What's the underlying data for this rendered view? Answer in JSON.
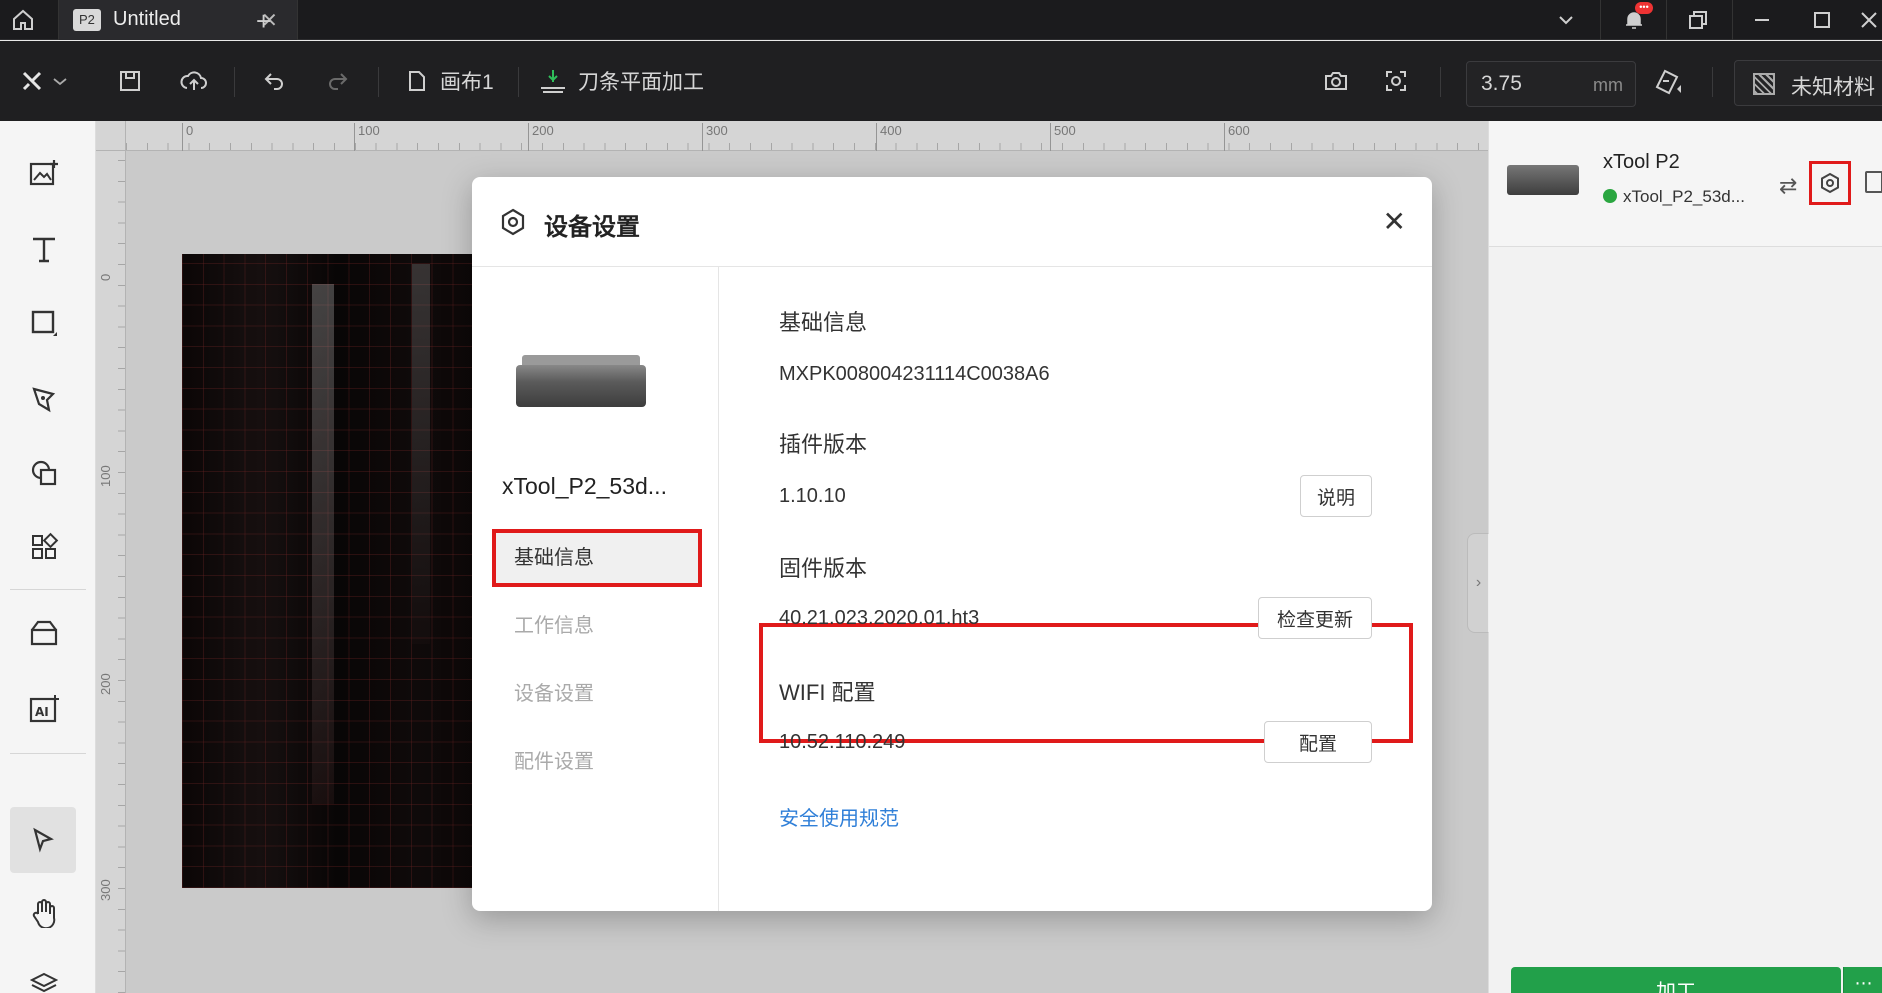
{
  "titlebar": {
    "tab_badge": "P2",
    "tab_title": "Untitled",
    "tab_close": "✕",
    "new_tab": "+",
    "notification_count": "•••",
    "minimize": "—",
    "maximize": "☐",
    "close": "✕"
  },
  "toolbar": {
    "canvas_label": "画布1",
    "mode_label": "刀条平面加工",
    "zoom_value": "3.75",
    "zoom_unit": "mm",
    "material_label": "未知材料"
  },
  "ruler": {
    "x_ticks": [
      "0",
      "100",
      "200",
      "300",
      "400",
      "500",
      "600"
    ],
    "y_ticks": [
      "0",
      "100",
      "200",
      "300"
    ]
  },
  "right_panel": {
    "device_model": "xTool P2",
    "device_id": "xTool_P2_53d...",
    "process_label": "加工",
    "process_more": "⋯"
  },
  "modal": {
    "title": "设备设置",
    "close": "✕",
    "device_name": "xTool_P2_53d...",
    "nav": [
      "基础信息",
      "工作信息",
      "设备设置",
      "配件设置"
    ],
    "basic_info_title": "基础信息",
    "serial_number": "MXPK008004231114C0038A6",
    "plugin_version_title": "插件版本",
    "plugin_version": "1.10.10",
    "plugin_button": "说明",
    "firmware_title": "固件版本",
    "firmware_version": "40.21.023.2020.01.ht3",
    "firmware_button": "检查更新",
    "wifi_title": "WIFI 配置",
    "wifi_ip": "10.52.110.249",
    "wifi_button": "配置",
    "safety_link": "安全使用规范"
  },
  "colors": {
    "highlight": "#e01a1a",
    "link": "#2f7fd8",
    "status_online": "#2aa640",
    "process_button": "#22a04a"
  }
}
